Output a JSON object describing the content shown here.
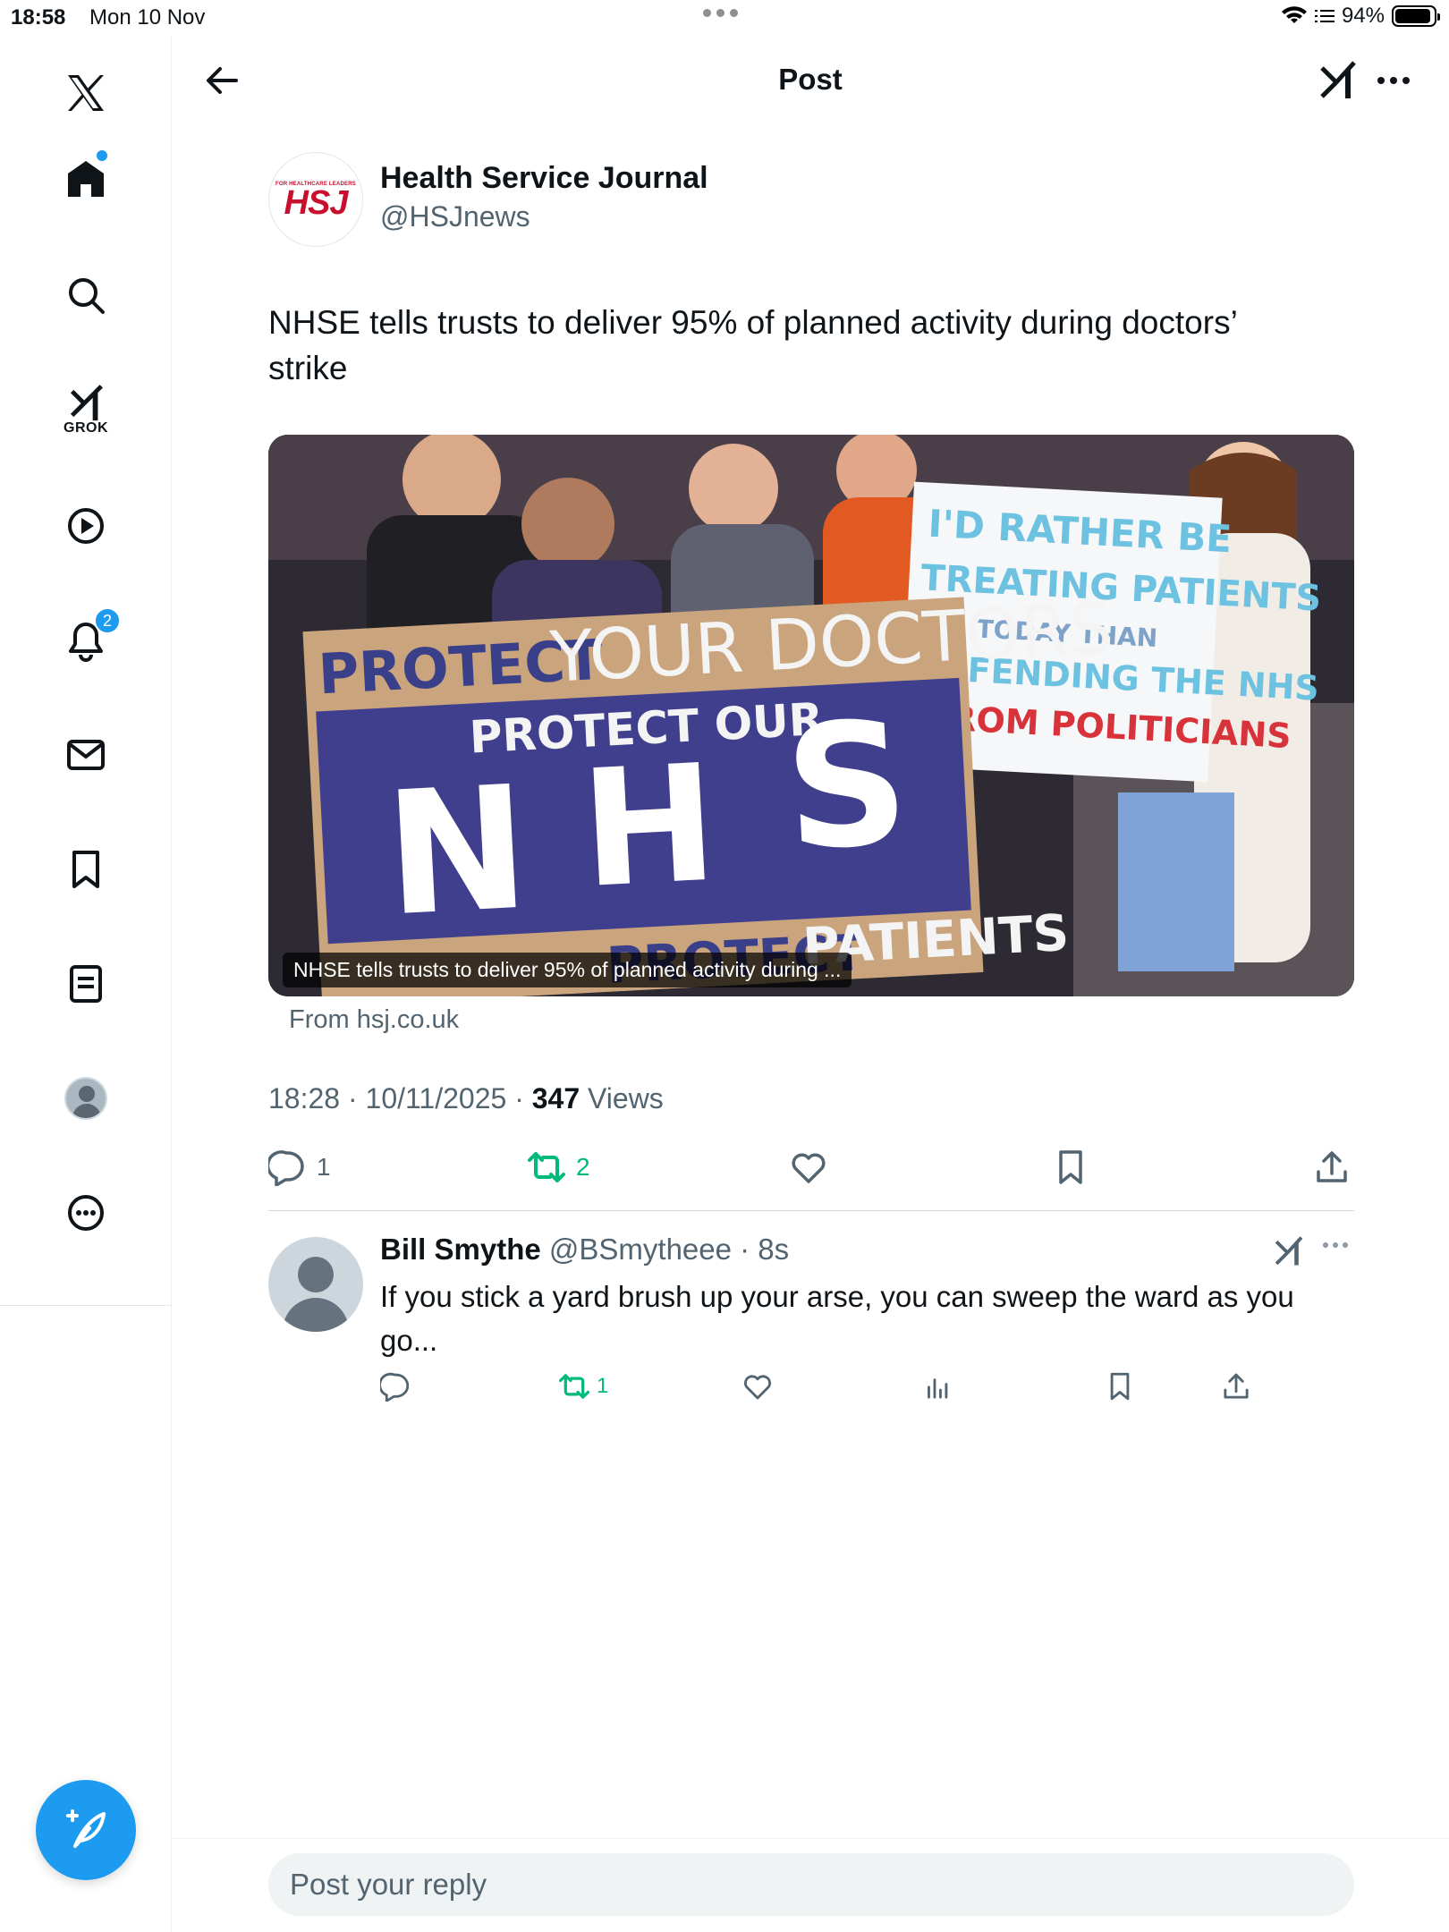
{
  "status_bar": {
    "time": "18:58",
    "date": "Mon 10 Nov",
    "battery": "94%",
    "battery_level": 0.94
  },
  "sidebar": {
    "items": [
      {
        "name": "x-logo-icon"
      },
      {
        "name": "home-icon",
        "has_dot": true
      },
      {
        "name": "search-icon"
      },
      {
        "name": "grok-icon",
        "label": "GROK"
      },
      {
        "name": "video-icon"
      },
      {
        "name": "notifications-icon",
        "badge": "2"
      },
      {
        "name": "messages-icon"
      },
      {
        "name": "bookmarks-icon"
      },
      {
        "name": "lists-icon"
      },
      {
        "name": "profile-icon"
      },
      {
        "name": "more-icon"
      }
    ],
    "compose_icon": "compose-feather-icon"
  },
  "header": {
    "title": "Post"
  },
  "post": {
    "author_name": "Health Service Journal",
    "author_handle": "@HSJnews",
    "avatar_logo": "HSJ",
    "avatar_tagline": "FOR HEALTHCARE LEADERS",
    "text": "NHSE tells trusts to deliver 95% of planned activity during doctors’ strike",
    "media_caption": "NHSE tells trusts to deliver 95% of planned activity during ...",
    "media_source": "From hsj.co.uk",
    "time": "18:28 · 10/11/2025 · ",
    "views_count": "347",
    "views_label": " Views",
    "actions": {
      "replies": "1",
      "reposts": "2",
      "likes": "",
      "bookmark": "",
      "share": ""
    },
    "colors": {
      "repost_active": "#00ba7c",
      "accent": "#1d9bf0",
      "hsj_red": "#c8102e"
    }
  },
  "reply": {
    "name": "Bill Smythe",
    "handle": " @BSmytheee · 8s",
    "text": "If you stick a yard brush up your arse, you can sweep the ward as you go...",
    "reposts": "1"
  },
  "composer": {
    "placeholder": "Post your reply"
  }
}
